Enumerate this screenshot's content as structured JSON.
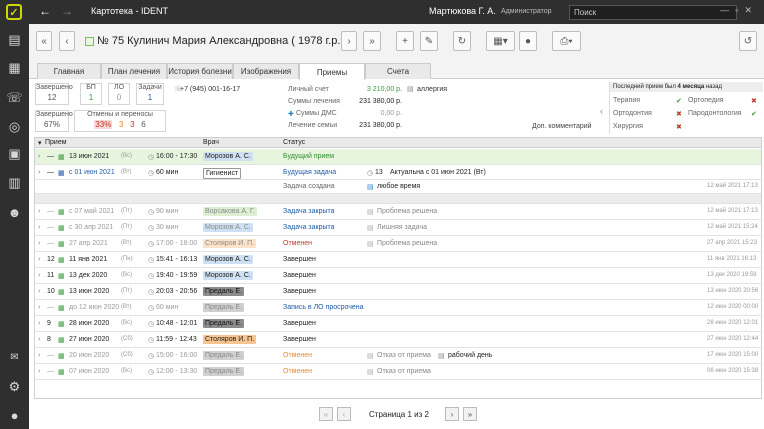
{
  "app": {
    "title": "Картотека - IDENT",
    "user": "Мартюкова Г. А.",
    "role": "Администратор",
    "search_placeholder": "Поиск",
    "accent": "#cfd600"
  },
  "patient": {
    "title": "№ 75 Кулинич Мария Александровна ( 1978 г.р. )",
    "phone": "+7 (945) 001-16-17"
  },
  "tabs": [
    "Главная",
    "План лечения",
    "История болезни",
    "Изображения",
    "Приемы",
    "Счета"
  ],
  "stats": {
    "boxes": [
      {
        "label": "Завершено",
        "value": "12"
      },
      {
        "label": "БП",
        "value": "1"
      },
      {
        "label": "ЛО",
        "value": "0"
      },
      {
        "label": "Задачи",
        "value": "1"
      }
    ],
    "pct_label": "Завершено",
    "pct": "67%",
    "cancel_label": "Отмены и переносы",
    "cancel": [
      "33%",
      "3",
      "3",
      "6"
    ]
  },
  "finance": [
    {
      "label": "Личный счет",
      "value": "3 210,00 р."
    },
    {
      "label": "Суммы лечения",
      "value": "231 380,00 р."
    },
    {
      "label": "Суммы ДМС",
      "value": "0,00 р."
    },
    {
      "label": "Лечение семьи",
      "value": "231 380,00 р."
    }
  ],
  "allergy": "аллергия",
  "add_comment": "Доп. комментарий",
  "last_visit": {
    "text": "Последний прием был",
    "value": "4 месяца",
    "suffix": "назад"
  },
  "specs": [
    {
      "name": "Терапия",
      "ok": true
    },
    {
      "name": "Ортопедия",
      "ok": false
    },
    {
      "name": "Ортодонтия",
      "ok": false
    },
    {
      "name": "Пародонтология",
      "ok": true
    },
    {
      "name": "Хирургия",
      "ok": false
    }
  ],
  "grid": {
    "headers": {
      "visit": "Прием",
      "doctor": "Врач",
      "status": "Статус"
    },
    "rows": [
      {
        "type": "future",
        "num": "—",
        "date": "13 июн 2021",
        "wd": "(Вс)",
        "time": "16:00 - 17:30",
        "doctor": "Морозов А. С.",
        "dc": "#cfe0f2",
        "status": "Будущий прием",
        "sc": "#2e8b2e",
        "note": "",
        "note2": "",
        "ts": ""
      },
      {
        "type": "task",
        "num": "—",
        "date": "с 01 июн 2021",
        "wd": "(Вт)",
        "time": "60 мин",
        "doctor": "Гигиенист",
        "dc": "#ffffff",
        "status": "Будущая задача",
        "sc": "#1e5aa8",
        "note": "13",
        "note2": "Актуальна с 01 июн 2021 (Вт)",
        "ts": ""
      },
      {
        "type": "created",
        "num": "",
        "date": "",
        "wd": "",
        "time": "",
        "doctor": "",
        "dc": "",
        "status": "Задача создана",
        "sc": "#666",
        "note": "любое время",
        "note2": "",
        "ts": "12 май 2021 17:13"
      },
      {
        "type": "sep"
      },
      {
        "type": "dim",
        "num": "—",
        "date": "с 07 май 2021",
        "wd": "(Пт)",
        "time": "90 мин",
        "doctor": "Ворсакова А. Г.",
        "dc": "#dcefd2",
        "status": "Задача закрыта",
        "sc": "#1e5aa8",
        "note": "Проблема решена",
        "note2": "",
        "ts": "12 май 2021 17:13"
      },
      {
        "type": "dim",
        "num": "—",
        "date": "с 30 апр 2021",
        "wd": "(Пт)",
        "time": "30 мин",
        "doctor": "Морозов А. С.",
        "dc": "#cfe0f2",
        "status": "Задача закрыта",
        "sc": "#1e5aa8",
        "note": "Лишняя задача",
        "note2": "",
        "ts": "12 май 2021 15:24"
      },
      {
        "type": "dim",
        "num": "—",
        "date": "27 апр 2021",
        "wd": "(Вт)",
        "time": "17:00 - 18:00",
        "doctor": "Столяров И. П.",
        "dc": "#fbe2c8",
        "status": "Отменен",
        "sc": "#c0392b",
        "note": "Проблема решена",
        "note2": "",
        "ts": "27 апр 2021 15:23"
      },
      {
        "type": "n",
        "num": "12",
        "date": "11 янв 2021",
        "wd": "(Пн)",
        "time": "15:41 - 16:13",
        "doctor": "Морозов А. С.",
        "dc": "#cfe0f2",
        "status": "Завершен",
        "sc": "#222",
        "note": "",
        "note2": "",
        "ts": "11 янв 2021 16:13"
      },
      {
        "type": "n",
        "num": "11",
        "date": "13 дек 2020",
        "wd": "(Вс)",
        "time": "19:40 - 19:59",
        "doctor": "Морозов А. С.",
        "dc": "#cfe0f2",
        "status": "Завершен",
        "sc": "#222",
        "note": "",
        "note2": "",
        "ts": "13 дек 2020 19:59"
      },
      {
        "type": "n",
        "num": "10",
        "date": "13 июн 2020",
        "wd": "(Пт)",
        "time": "20:03 - 20:56",
        "doctor": "Предаль Е.",
        "dc": "#8c8c8c",
        "status": "Завершен",
        "sc": "#222",
        "note": "",
        "note2": "",
        "ts": "13 июн 2020 20:56"
      },
      {
        "type": "dim",
        "num": "—",
        "date": "до 12 июн 2020",
        "wd": "(Вт)",
        "time": "60 мин",
        "doctor": "Предаль Е.",
        "dc": "#d0d0d0",
        "status": "Запись в ЛО просрочена",
        "sc": "#1e5aa8",
        "note": "",
        "note2": "",
        "ts": "12 июн 2020 00:00"
      },
      {
        "type": "n",
        "num": "9",
        "date": "28 июн 2020",
        "wd": "(Вс)",
        "time": "10:48 - 12:01",
        "doctor": "Предаль Е.",
        "dc": "#8c8c8c",
        "status": "Завершен",
        "sc": "#222",
        "note": "",
        "note2": "",
        "ts": "28 июн 2020 12:01"
      },
      {
        "type": "n",
        "num": "8",
        "date": "27 июн 2020",
        "wd": "(Сб)",
        "time": "11:59 - 12:43",
        "doctor": "Столяров И. П.",
        "dc": "#f5c48f",
        "status": "Завершен",
        "sc": "#222",
        "note": "",
        "note2": "",
        "ts": "27 июн 2020 12:44"
      },
      {
        "type": "dim",
        "num": "—",
        "date": "20 июн 2020",
        "wd": "(Сб)",
        "time": "15:00 - 16:00",
        "doctor": "Предаль Е.",
        "dc": "#d0d0d0",
        "status": "Отменен",
        "sc": "#e08a2c",
        "note": "Отказ от приема",
        "note2": "рабочий день",
        "ts": "17 июн 2020 15:00"
      },
      {
        "type": "dim",
        "num": "—",
        "date": "07 июн 2020",
        "wd": "(Вс)",
        "time": "12:00 - 13:30",
        "doctor": "Предаль Е.",
        "dc": "#d0d0d0",
        "status": "Отменен",
        "sc": "#e08a2c",
        "note": "Отказ от приема",
        "note2": "",
        "ts": "06 июн 2020 15:38"
      }
    ]
  },
  "pager": {
    "text": "Страница 1 из 2"
  }
}
